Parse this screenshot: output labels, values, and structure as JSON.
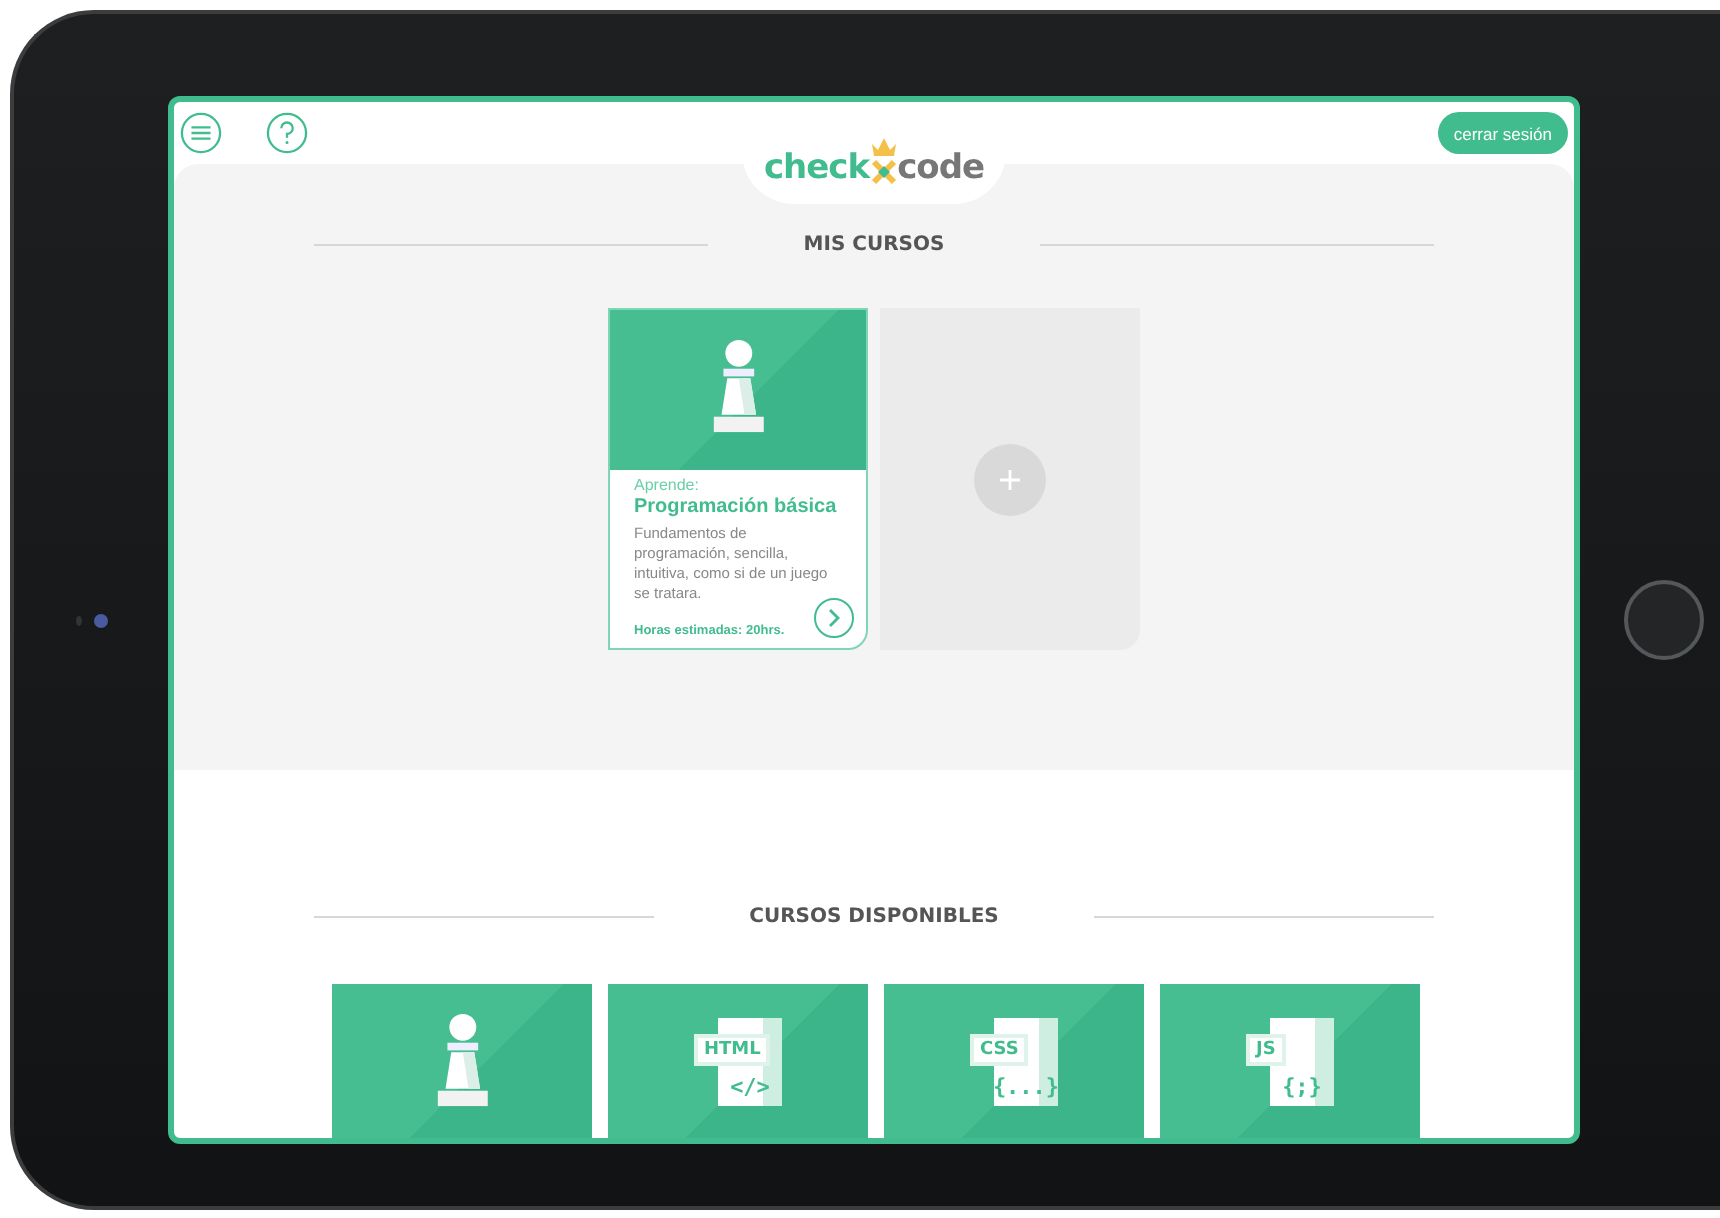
{
  "header": {
    "logo": {
      "left": "check",
      "right": "code"
    },
    "logout_button": "cerrar sesión"
  },
  "my_courses": {
    "title": "MIS CURSOS",
    "courses": [
      {
        "kind": "pawn",
        "kicker": "Aprende:",
        "title": "Programación básica",
        "description": "Fundamentos de programación, sencilla, intuitiva, como si de un juego se tratara.",
        "hours": "Horas estimadas: 20hrs."
      }
    ]
  },
  "available_courses": {
    "title": "CURSOS DISPONIBLES",
    "courses": [
      {
        "kind": "pawn"
      },
      {
        "kind": "file",
        "label": "HTML",
        "symbol": "</>"
      },
      {
        "kind": "file",
        "label": "CSS",
        "symbol": "{...}"
      },
      {
        "kind": "file",
        "label": "JS",
        "symbol": "{;}"
      }
    ]
  }
}
